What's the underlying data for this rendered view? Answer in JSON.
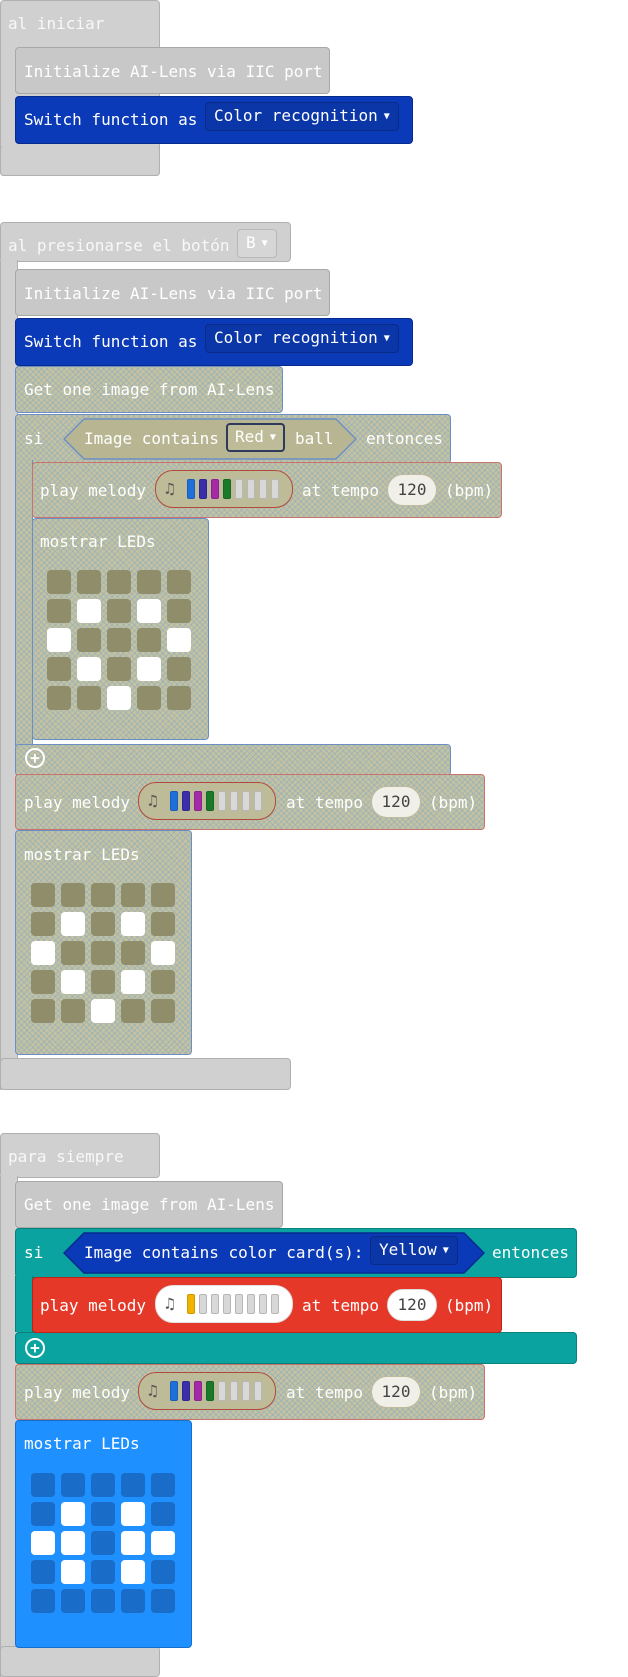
{
  "colors": {
    "event_grey": "#d0d0d0",
    "ailens_navy": "#0b3ab8",
    "disabled_hatch": "#c4c2a0",
    "logic_teal": "#0aa39f",
    "music_red": "#e53828",
    "basic_blue": "#1e90ff",
    "led_on": "#ffffff"
  },
  "stack1": {
    "hat_label": "al iniciar",
    "init_label": "Initialize AI-Lens via IIC port",
    "switch_label": "Switch function as",
    "switch_value": "Color recognition"
  },
  "stack2": {
    "hat_label": "al presionarse el botón",
    "button_value": "B",
    "init_label": "Initialize AI-Lens via IIC port",
    "switch_label": "Switch function as",
    "switch_value": "Color recognition",
    "get_image_label": "Get one image from AI-Lens",
    "if_label": "si",
    "cond_prefix": "Image contains",
    "cond_value": "Red",
    "cond_suffix": "ball",
    "then_label": "entonces",
    "melody1": {
      "label": "play melody",
      "tempo_label": "at tempo",
      "tempo": "120",
      "unit": "(bpm)"
    },
    "leds1_label": "mostrar LEDs",
    "melody2": {
      "label": "play melody",
      "tempo_label": "at tempo",
      "tempo": "120",
      "unit": "(bpm)"
    },
    "leds2_label": "mostrar LEDs"
  },
  "stack3": {
    "hat_label": "para siempre",
    "get_image_label": "Get one image from AI-Lens",
    "if_label": "si",
    "cond_prefix": "Image contains color card(s):",
    "cond_value": "Yellow",
    "then_label": "entonces",
    "melody1": {
      "label": "play melody",
      "tempo_label": "at tempo",
      "tempo": "120",
      "unit": "(bpm)"
    },
    "melody2": {
      "label": "play melody",
      "tempo_label": "at tempo",
      "tempo": "120",
      "unit": "(bpm)"
    },
    "leds_label": "mostrar LEDs"
  },
  "melody_colors": {
    "melody_a": [
      "#1e6fd9",
      "#3a2fa8",
      "#a52aa8",
      "#1a7a2a",
      "#d8d8d8",
      "#d8d8d8",
      "#d8d8d8",
      "#d8d8d8"
    ],
    "melody_b": [
      "#1e6fd9",
      "#3a2fa8",
      "#a52aa8",
      "#1a7a2a",
      "#d8d8d8",
      "#d8d8d8",
      "#d8d8d8",
      "#d8d8d8"
    ],
    "melody_c": [
      "#f0b400",
      "#d8d8d8",
      "#d8d8d8",
      "#d8d8d8",
      "#d8d8d8",
      "#d8d8d8",
      "#d8d8d8",
      "#d8d8d8"
    ],
    "melody_d": [
      "#1e6fd9",
      "#3a2fa8",
      "#a52aa8",
      "#1a7a2a",
      "#d8d8d8",
      "#d8d8d8",
      "#d8d8d8",
      "#d8d8d8"
    ]
  },
  "led_patterns": {
    "leds1": [
      [
        0,
        0,
        0,
        0,
        0
      ],
      [
        0,
        1,
        0,
        1,
        0
      ],
      [
        1,
        0,
        0,
        0,
        1
      ],
      [
        0,
        1,
        0,
        1,
        0
      ],
      [
        0,
        0,
        1,
        0,
        0
      ]
    ],
    "leds2": [
      [
        0,
        0,
        0,
        0,
        0
      ],
      [
        0,
        1,
        0,
        1,
        0
      ],
      [
        1,
        0,
        0,
        0,
        1
      ],
      [
        0,
        1,
        0,
        1,
        0
      ],
      [
        0,
        0,
        1,
        0,
        0
      ]
    ],
    "leds3": [
      [
        0,
        0,
        0,
        0,
        0
      ],
      [
        0,
        1,
        0,
        1,
        0
      ],
      [
        1,
        1,
        0,
        1,
        1
      ],
      [
        0,
        1,
        0,
        1,
        0
      ],
      [
        0,
        0,
        0,
        0,
        0
      ]
    ]
  }
}
